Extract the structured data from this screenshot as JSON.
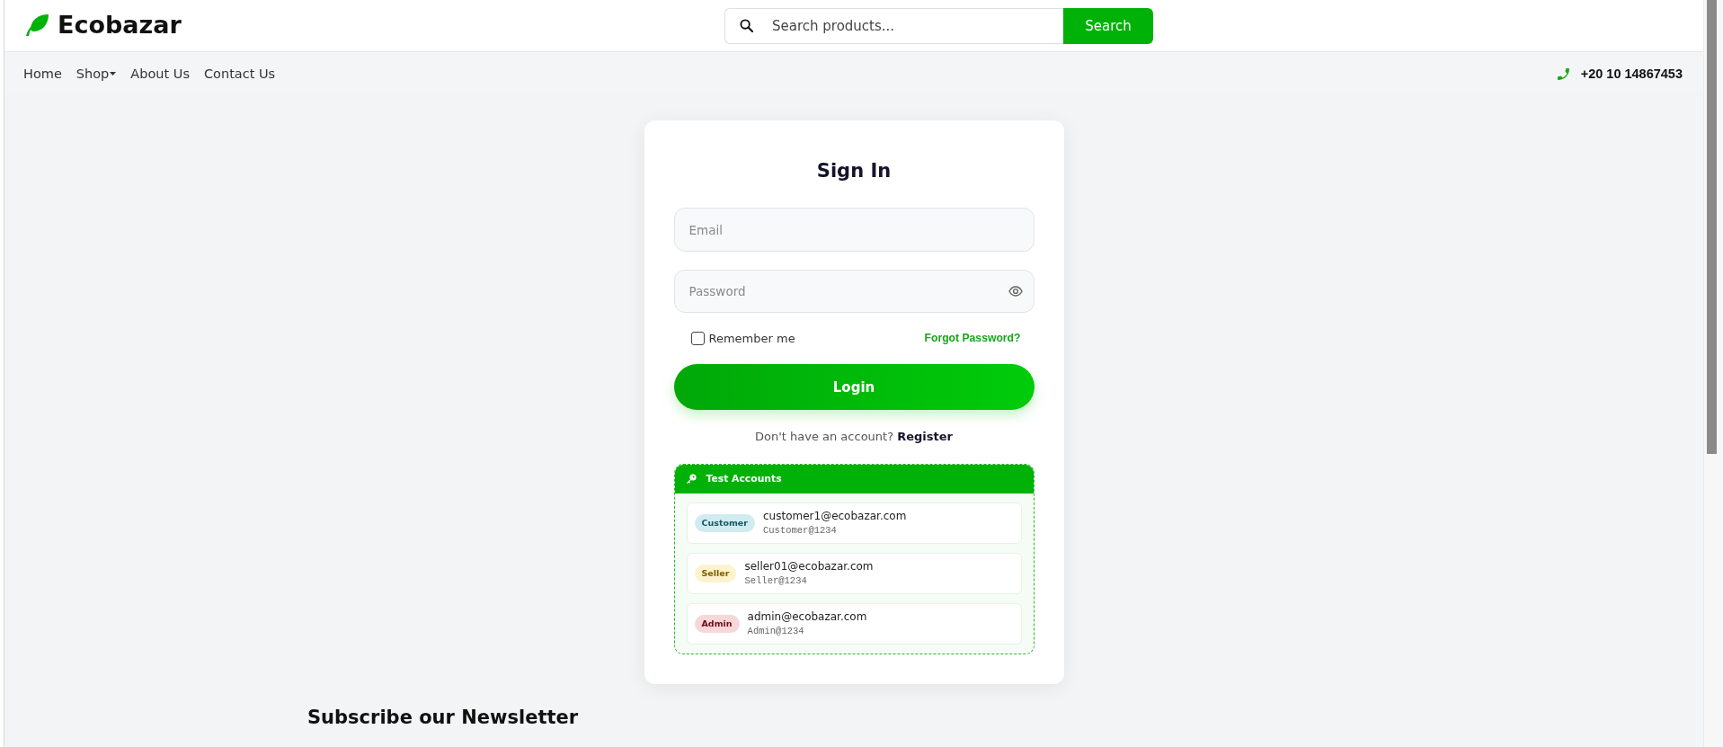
{
  "header": {
    "logo": "Ecobazar",
    "search": {
      "placeholder": "Search products...",
      "button": "Search"
    }
  },
  "nav": {
    "items": [
      {
        "label": "Home",
        "dropdown": false
      },
      {
        "label": "Shop",
        "dropdown": true
      },
      {
        "label": "About Us",
        "dropdown": false
      },
      {
        "label": "Contact Us",
        "dropdown": false
      }
    ],
    "phone": "+20 10 14867453"
  },
  "sign_in": {
    "title": "Sign In",
    "email": {
      "placeholder": "Email"
    },
    "password": {
      "placeholder": "Password"
    },
    "remember": {
      "label": "Remember me",
      "checked": false
    },
    "forgot_link": "Forgot Password?",
    "login_button": "Login",
    "register_prompt": "Don't have an account?",
    "register_link": "Register",
    "test_accounts": {
      "title": "Test Accounts",
      "accounts": [
        {
          "role": "Customer",
          "color": "#d1ecf1",
          "email": "customer1@ecobazar.com",
          "password": "Customer@1234"
        },
        {
          "role": "Seller",
          "color": "#fff3cd",
          "email": "seller01@ecobazar.com",
          "password": "Seller@1234"
        },
        {
          "role": "Admin",
          "color": "#f8d7da",
          "email": "admin@ecobazar.com",
          "password": "Admin@1234"
        }
      ]
    }
  },
  "newsletter": {
    "title": "Subscribe our Newsletter"
  }
}
